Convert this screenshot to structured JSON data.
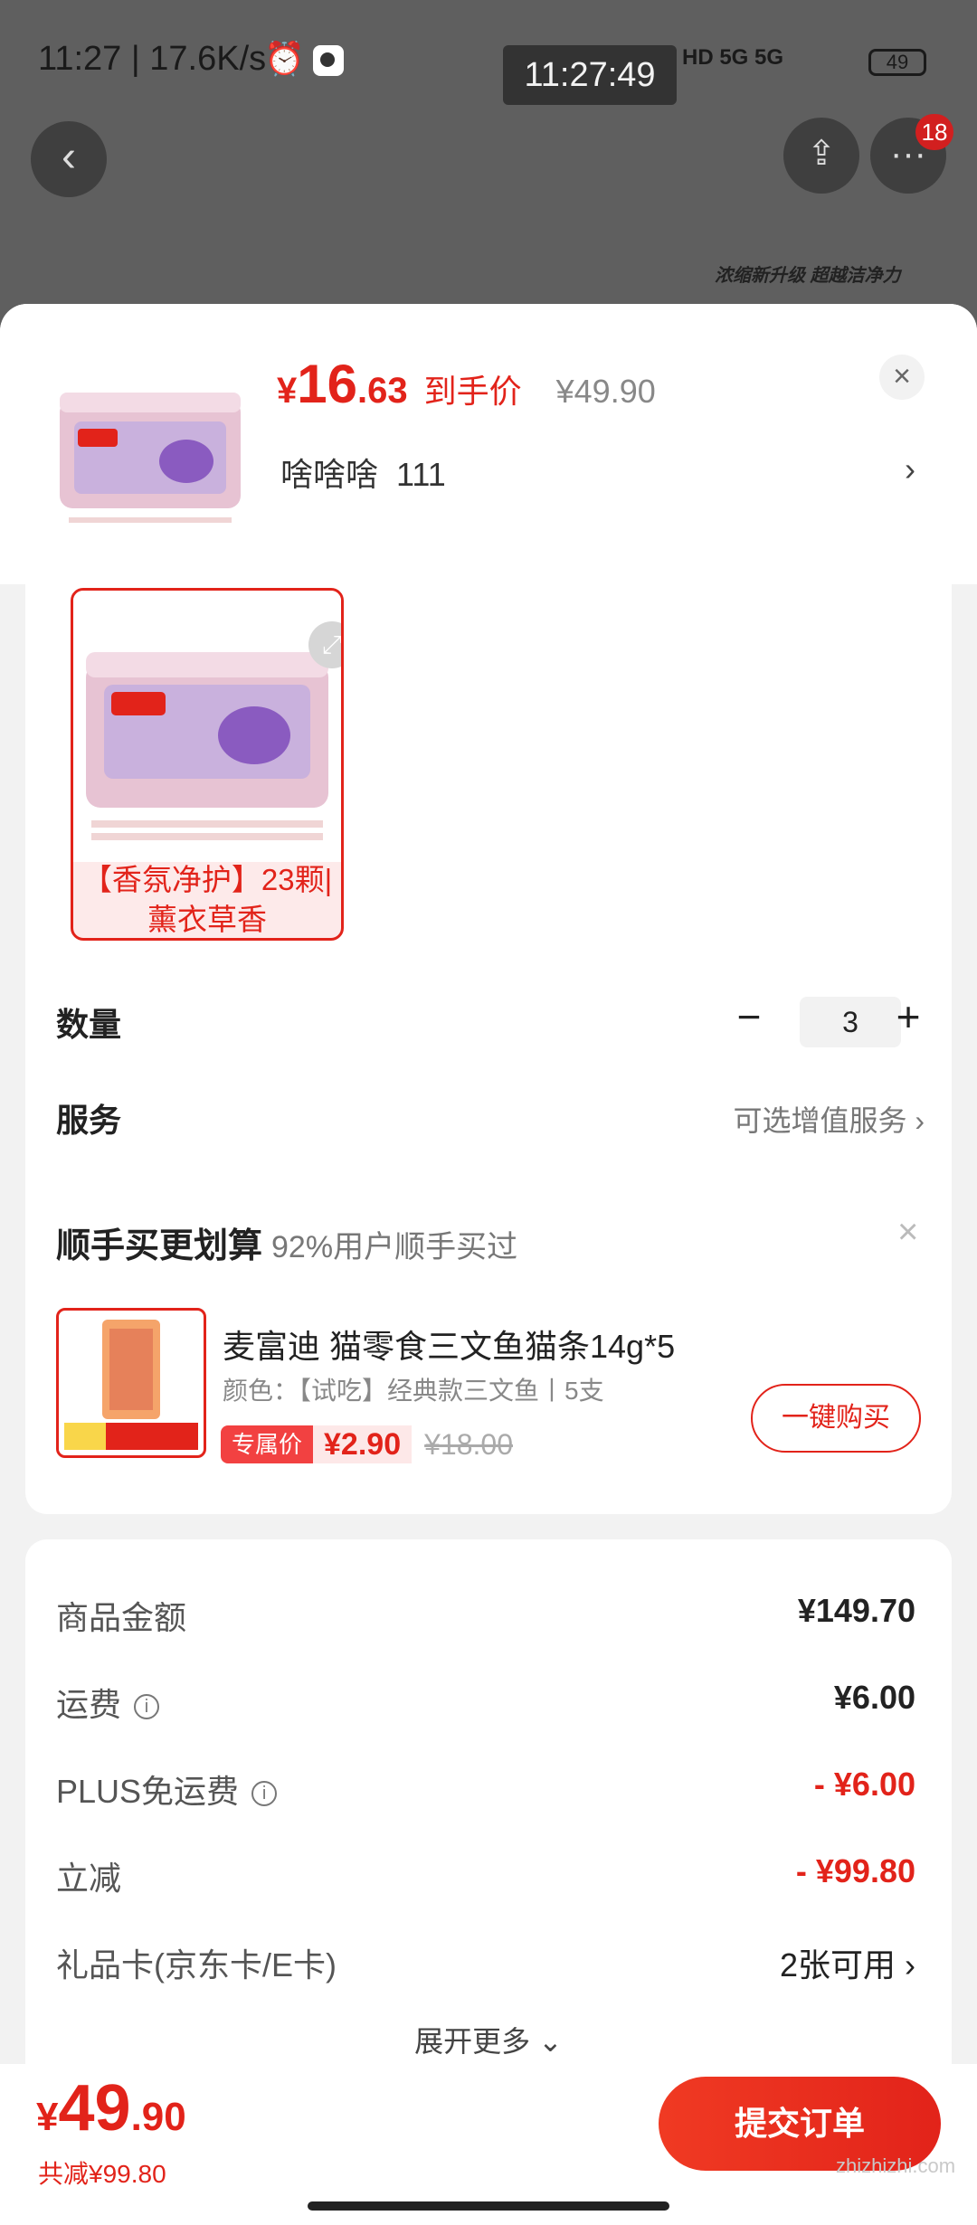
{
  "status_bar": {
    "time_speed": "11:27 | 17.6K/s",
    "overlay_time": "11:27:49",
    "network": "HD 5G 5G",
    "battery": "49"
  },
  "header": {
    "badge_count": "18",
    "banner_text": "浓缩新升级 超越洁净力"
  },
  "product": {
    "price_currency": "¥",
    "price_int": "16",
    "price_dec": ".63",
    "price_tag": "到手价",
    "original_price": "¥49.90",
    "sku_name": "啥啥啥",
    "sku_code": "111",
    "variant_label": "【香氛净护】23颗|薰衣草香"
  },
  "quantity": {
    "label": "数量",
    "value": "3"
  },
  "service": {
    "label": "服务",
    "value": "可选增值服务"
  },
  "addon": {
    "title": "顺手买更划算",
    "subtitle": "92%用户顺手买过",
    "name": "麦富迪 猫零食三文鱼猫条14g*5",
    "spec": "颜色：【试吃】经典款三文鱼丨5支",
    "vip_tag": "专属价",
    "vip_price": "¥2.90",
    "original_price": "¥18.00",
    "buy_label": "一键购买"
  },
  "summary": {
    "rows": [
      {
        "label": "商品金额",
        "value": "¥149.70"
      },
      {
        "label": "运费",
        "value": "¥6.00"
      },
      {
        "label": "PLUS免运费",
        "value": "- ¥6.00"
      },
      {
        "label": "立减",
        "value": "- ¥99.80"
      },
      {
        "label": "礼品卡(京东卡/E卡)",
        "value": "2张可用 ›"
      }
    ],
    "more": "展开更多"
  },
  "footer": {
    "currency": "¥",
    "total_int": "49",
    "total_dec": ".90",
    "saved": "共减¥99.80",
    "submit": "提交订单",
    "watermark": "zhizhizhi.com"
  },
  "colors": {
    "accent": "#e2231a",
    "overlay": "#5f5f5f"
  }
}
